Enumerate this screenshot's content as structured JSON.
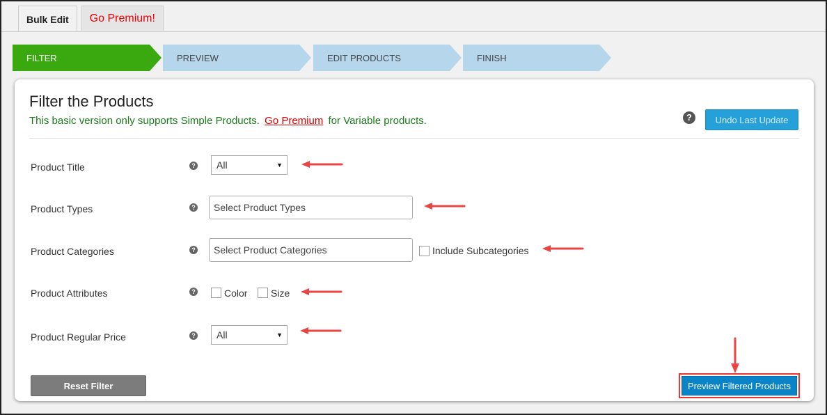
{
  "tabs": [
    {
      "label": "Bulk Edit"
    },
    {
      "label": "Go Premium!"
    }
  ],
  "steps": [
    {
      "label": "FILTER"
    },
    {
      "label": "PREVIEW"
    },
    {
      "label": "EDIT PRODUCTS"
    },
    {
      "label": "FINISH"
    }
  ],
  "panel": {
    "title": "Filter the Products",
    "notice_before": "This basic version only supports Simple Products.",
    "notice_link": "Go Premium",
    "notice_after": "for Variable products.",
    "undo_button": "Undo Last Update",
    "help_glyph": "?"
  },
  "filters": {
    "product_title": {
      "label": "Product Title",
      "selected": "All"
    },
    "product_types": {
      "label": "Product Types",
      "placeholder": "Select Product Types"
    },
    "product_categories": {
      "label": "Product Categories",
      "placeholder": "Select Product Categories",
      "subcategories_label": "Include Subcategories"
    },
    "product_attributes": {
      "label": "Product Attributes",
      "options": [
        "Color",
        "Size"
      ]
    },
    "product_regular_price": {
      "label": "Product Regular Price",
      "selected": "All"
    }
  },
  "buttons": {
    "reset": "Reset Filter",
    "preview": "Preview Filtered Products"
  },
  "colors": {
    "active_step": "#3aa80f",
    "inactive_step": "#b6d6ec",
    "primary_button": "#0a84c6",
    "annotation_arrow": "#e84545",
    "notice_text": "#1a7a1a"
  }
}
